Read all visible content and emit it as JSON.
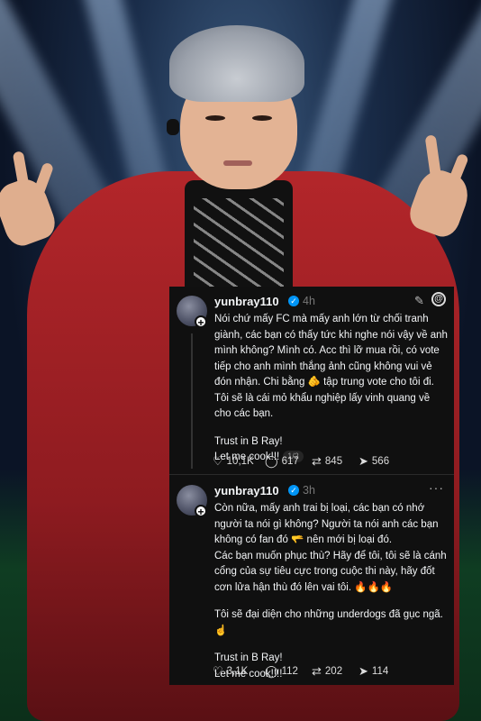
{
  "post1": {
    "username": "yunbray110",
    "time": "4h",
    "paragraphs": [
      "Nói chứ mấy FC mà mấy anh lớn từ chối tranh giành, các bạn có thấy tức khi nghe nói vậy về anh mình không? Mình có. Acc thì lỡ mua rồi, có vote tiếp cho anh mình thắng ảnh cũng không vui vẻ đón nhận. Chi bằng 🫵 tập trung vote cho tôi đi. Tôi sẽ là cái mỏ khẩu nghiệp lấy vinh quang về cho các bạn.",
      "Trust in B Ray!"
    ],
    "last_line": "Let me cook!!!",
    "page_counter": "1/2",
    "likes": "10,1K",
    "comments": "617",
    "reposts": "845",
    "shares": "566"
  },
  "post2": {
    "username": "yunbray110",
    "time": "3h",
    "line1": "Còn nữa, mấy anh trai bị loại, các bạn có nhớ người ta nói gì không? Người ta nói anh các bạn không có fan đó 🫳 nên mới bị loại đó.",
    "line2": "Các bạn muốn phục thù? Hãy để tôi, tôi sẽ là cánh cổng của sự tiêu cực trong cuộc thi này, hãy đốt cơn lửa hận thù đó lên vai tôi. 🔥🔥🔥",
    "line3": "Tôi sẽ đại diện cho những underdogs đã gục ngã. ☝️",
    "line4": "Trust in B Ray!",
    "line5": "Let me cook!!!!",
    "likes": "3,1K",
    "comments": "112",
    "reposts": "202",
    "shares": "114"
  },
  "icons": {
    "verified": "verified-badge",
    "edit": "pencil-icon",
    "threads": "threads-logo",
    "more": "more-icon",
    "like": "heart-icon",
    "comment": "comment-icon",
    "repost": "repost-icon",
    "share": "share-icon"
  },
  "colors": {
    "card_bg": "#101010",
    "verified_blue": "#0095f6",
    "jacket_red": "#b3262a"
  }
}
